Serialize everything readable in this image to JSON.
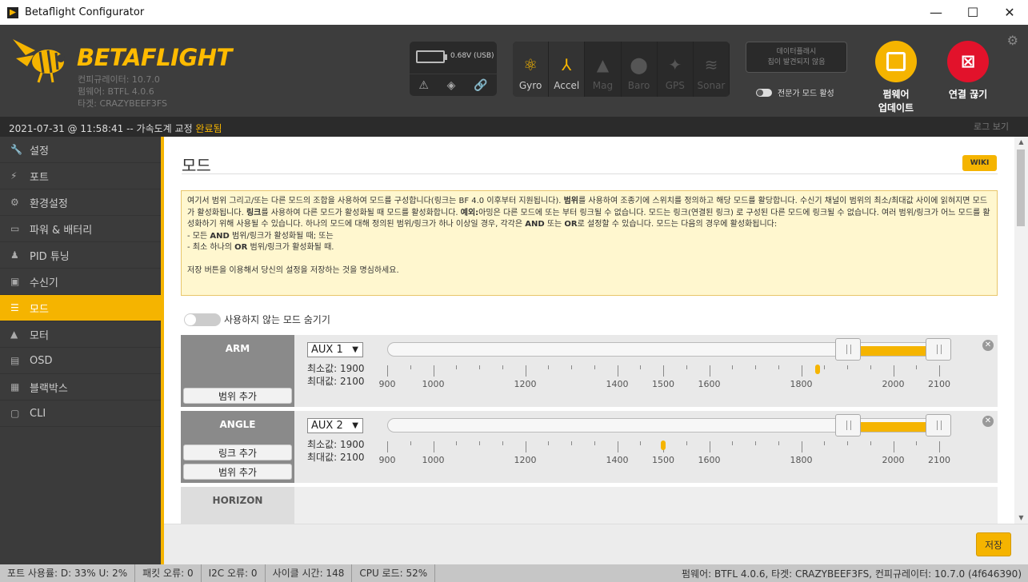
{
  "window": {
    "title": "Betaflight Configurator",
    "minimize": "—",
    "maximize": "☐",
    "close": "✕"
  },
  "header": {
    "brand": "BETAFLIGHT",
    "configurator_version": "컨피규레이터: 10.7.0",
    "firmware": "펌웨어: BTFL 4.0.6",
    "target": "타겟: CRAZYBEEF3FS",
    "battery_voltage": "0.68V (USB)",
    "sensors": [
      {
        "label": "Gyro",
        "icon": "gyro-icon",
        "state": "on"
      },
      {
        "label": "Accel",
        "icon": "accel-icon",
        "state": "on"
      },
      {
        "label": "Mag",
        "icon": "mag-icon",
        "state": "off"
      },
      {
        "label": "Baro",
        "icon": "baro-icon",
        "state": "off"
      },
      {
        "label": "GPS",
        "icon": "gps-icon",
        "state": "off"
      },
      {
        "label": "Sonar",
        "icon": "sonar-icon",
        "state": "off"
      }
    ],
    "dataflash_line1": "데이터플래시",
    "dataflash_line2": "칩이 발견되지 않음",
    "expert_mode": "전문가 모드 활성",
    "firmware_update_line1": "펌웨어",
    "firmware_update_line2": "업데이트",
    "disconnect": "연결 끊기"
  },
  "status": {
    "timestamp": "2021-07-31 @ 11:58:41 -- 가속도계 교정 ",
    "result": "완료됨",
    "show_log": "로그 보기"
  },
  "sidebar": [
    {
      "label": "설정",
      "icon": "wrench-icon",
      "glyph": "🔧"
    },
    {
      "label": "포트",
      "icon": "plug-icon",
      "glyph": "⚡"
    },
    {
      "label": "환경설정",
      "icon": "gear-icon",
      "glyph": "⚙"
    },
    {
      "label": "파워 & 배터리",
      "icon": "battery-icon",
      "glyph": "▭"
    },
    {
      "label": "PID 튜닝",
      "icon": "pid-icon",
      "glyph": "♟"
    },
    {
      "label": "수신기",
      "icon": "receiver-icon",
      "glyph": "▣"
    },
    {
      "label": "모드",
      "icon": "modes-icon",
      "glyph": "☰",
      "active": true
    },
    {
      "label": "모터",
      "icon": "motor-icon",
      "glyph": "▲"
    },
    {
      "label": "OSD",
      "icon": "osd-icon",
      "glyph": "▤"
    },
    {
      "label": "블랙박스",
      "icon": "blackbox-icon",
      "glyph": "▦"
    },
    {
      "label": "CLI",
      "icon": "cli-icon",
      "glyph": "▢"
    }
  ],
  "page": {
    "title": "모드",
    "wiki": "WIKI",
    "note_p1": "여기서 범위 그리고/또는 다른 모드의 조합을 사용하여 모드를 구성합니다(링크는 BF 4.0 이후부터 지원됩니다). ",
    "note_b1": "범위",
    "note_p2": "를 사용하여 조종기에 스위치를 정의하고 해당 모드를 활당합니다. 수신기 채널이 범위의 최소/최대값 사이에 읽혀지면 모드가 활성화됩니다. ",
    "note_b2": "링크",
    "note_p3": "를 사용하여 다른 모드가 활성화될 때 모드를 활성화합니다. ",
    "note_b3": "예외:",
    "note_p4": "아밍은 다른 모드에 또는 부터 링크될 수 없습니다. 모드는 링크(연결된 링크) 로 구성된 다른 모드에 링크될 수 없습니다. 여러 범위/링크가 어느 모드를 활성화하기 위해 사용될 수 있습니다. 하나의 모드에 대해 정의된 범위/링크가 하나 이상일 경우, 각각은 ",
    "note_b4": "AND",
    "note_p5": " 또는 ",
    "note_b5": "OR",
    "note_p6": "로 설정할 수 있습니다. 모드는 다음의 경우에 활성화됩니다:",
    "note_li1a": "- 모든 ",
    "note_li1b": "AND",
    "note_li1c": " 범위/링크가 활성화될 때; 또는",
    "note_li2a": "- 최소 하나의 ",
    "note_li2b": "OR",
    "note_li2c": " 범위/링크가 활성화될 때.",
    "note_save": "저장 버튼을 이용해서 당신의 설정을 저장하는 것을 명심하세요.",
    "hide_unused": "사용하지 않는 모드 숨기기",
    "min_prefix": "최소값: ",
    "max_prefix": "최대값: ",
    "add_range": "범위 추가",
    "add_link": "링크 추가",
    "ticks": [
      "900",
      "1000",
      "1200",
      "1400",
      "1500",
      "1600",
      "1800",
      "2000",
      "2100"
    ],
    "modes": [
      {
        "name": "ARM",
        "aux": "AUX 1",
        "min": "1900",
        "max": "2100",
        "range_min": 1900,
        "range_max": 2100,
        "channel_value": 1835
      },
      {
        "name": "ANGLE",
        "aux": "AUX 2",
        "min": "1900",
        "max": "2100",
        "range_min": 1900,
        "range_max": 2100,
        "channel_value": 1500
      },
      {
        "name": "HORIZON"
      }
    ],
    "save": "저장"
  },
  "footer": {
    "port_usage": "포트 사용률: D: 33% U: 2%",
    "packet_errors": "패킷 오류: 0",
    "i2c_errors": "I2C 오류: 0",
    "cycle_time": "사이클 시간: 148",
    "cpu_load": "CPU 로드: 52%",
    "versions": "펌웨어: BTFL 4.0.6, 타겟: CRAZYBEEF3FS, 컨피규레이터: 10.7.0 (4f646390)"
  }
}
